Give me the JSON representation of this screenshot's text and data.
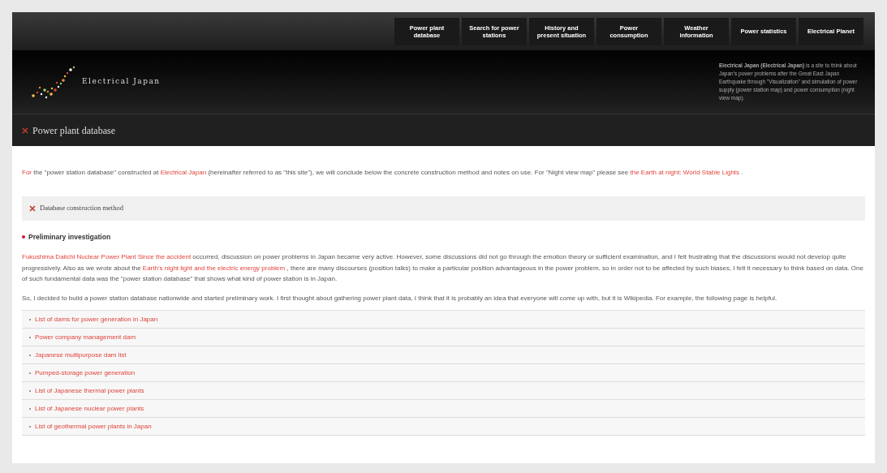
{
  "nav": [
    {
      "label": "Power plant database"
    },
    {
      "label": "Search for power stations"
    },
    {
      "label": "History and present situation"
    },
    {
      "label": "Power consumption"
    },
    {
      "label": "Weather information"
    },
    {
      "label": "Power statistics"
    },
    {
      "label": "Electrical Planet"
    }
  ],
  "header": {
    "logo_text": "Electrical Japan",
    "description": "**Electrical Japan (Electrical Japan)** is a site to think about Japan's power problems after the Great East Japan Earthquake through \"Visualization\" and simulation of power supply (power station map) and power consumption (night view map)."
  },
  "page_title": "Power plant database",
  "intro": [
    {
      "kind": "link",
      "text": "For"
    },
    {
      "kind": "text",
      "text": " the \"power station database\" constructed at "
    },
    {
      "kind": "link",
      "text": "Electrical Japan"
    },
    {
      "kind": "text",
      "text": " (hereinafter referred to as \"this site\"), we will conclude below the concrete construction method and notes on use. For \"Night view map\" please see "
    },
    {
      "kind": "link",
      "text": "the Earth at night: World Stable Lights"
    },
    {
      "kind": "text",
      "text": " ."
    }
  ],
  "section_title": "Database construction method",
  "subsection_title": "Preliminary investigation",
  "paragraphs": [
    [
      {
        "kind": "link",
        "text": "Fukushima Daiichi Nuclear Power Plant Since the accident"
      },
      {
        "kind": "text",
        "text": " occurred, discussion on power problems in Japan became very active. However, some discussions did not go through the emotion theory or sufficient examination, and I felt frustrating that the discussions would not develop quite progressively. Also as we wrote about the "
      },
      {
        "kind": "link",
        "text": "Earth's night light and the electric energy problem"
      },
      {
        "kind": "text",
        "text": " , there are many discourses (position talks) to make a particular position advantageous in the power problem, so in order not to be affected by such biases, I felt it necessary to think based on data. One of such fundamental data was the \"power station database\" that shows what kind of power station is in Japan."
      }
    ],
    [
      {
        "kind": "text",
        "text": "So, I decided to build a power station database nationwide and started preliminary work. I first thought about gathering power plant data, I think that it is probably an idea that everyone will come up with, but it is Wikipedia. For example, the following page is helpful."
      }
    ]
  ],
  "links": [
    "List of dams for power generation in Japan",
    "Power company management dam",
    "Japanese multipurpose dam list",
    "Pumped-storage power generation",
    "List of Japanese thermal power plants",
    "List of Japanese nuclear power plants",
    "List of geothermal power plants in Japan"
  ]
}
